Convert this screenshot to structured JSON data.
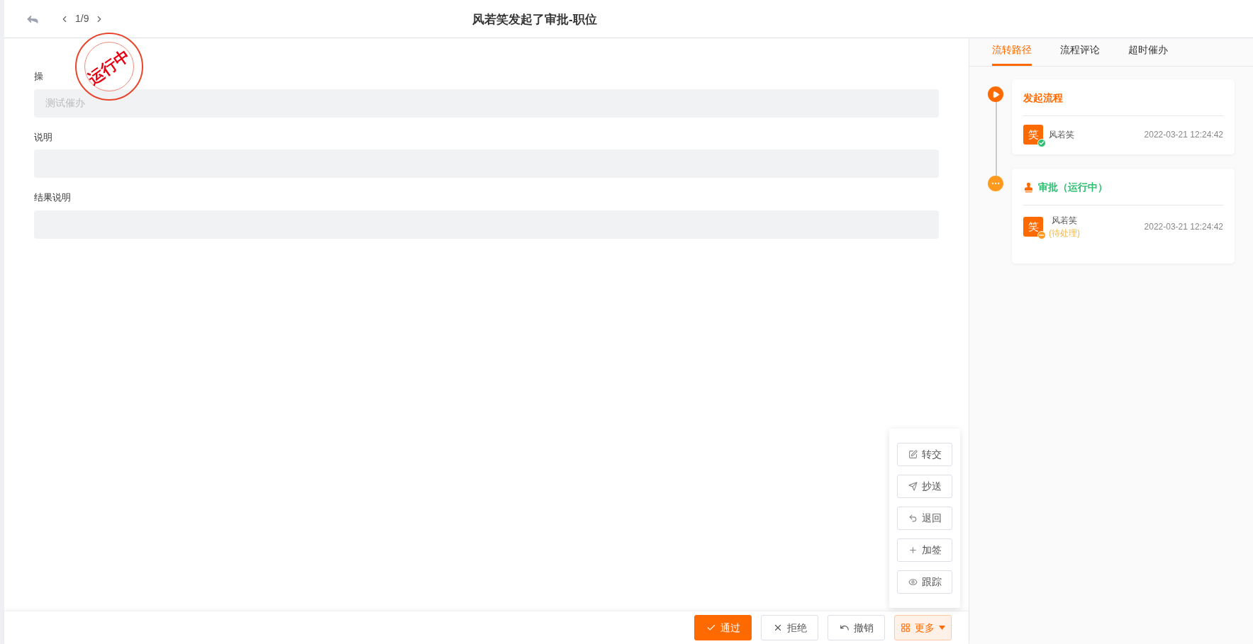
{
  "header": {
    "counter": "1/9",
    "title": "风若笑发起了审批-职位"
  },
  "stamp": {
    "text": "运行中"
  },
  "form": [
    {
      "label": "操",
      "value": "测试催办"
    },
    {
      "label": "说明"
    },
    {
      "label": "结果说明"
    }
  ],
  "tabs": [
    {
      "label": "流转路径",
      "selected": true
    },
    {
      "label": "流程评论",
      "selected": false
    },
    {
      "label": "超时催办",
      "selected": false
    }
  ],
  "timeline": [
    {
      "kind": "start",
      "title": "发起流程",
      "entries": [
        {
          "avatar": "笑",
          "name": "风若笑",
          "time": "2022-03-21 12:24:42"
        }
      ]
    },
    {
      "kind": "approval",
      "title": "审批（运行中）",
      "entries": [
        {
          "avatar": "笑",
          "name": "风若笑",
          "status": "(待处理)",
          "time": "2022-03-21 12:24:42"
        }
      ]
    }
  ],
  "more_menu": [
    {
      "label": "转交"
    },
    {
      "label": "抄送"
    },
    {
      "label": "退回"
    },
    {
      "label": "加签"
    },
    {
      "label": "跟踪"
    }
  ],
  "footer": [
    {
      "kind": "primary",
      "label": "通过"
    },
    {
      "kind": "default",
      "label": "拒绝"
    },
    {
      "kind": "default",
      "label": "撤销"
    },
    {
      "kind": "more",
      "label": "更多"
    }
  ]
}
